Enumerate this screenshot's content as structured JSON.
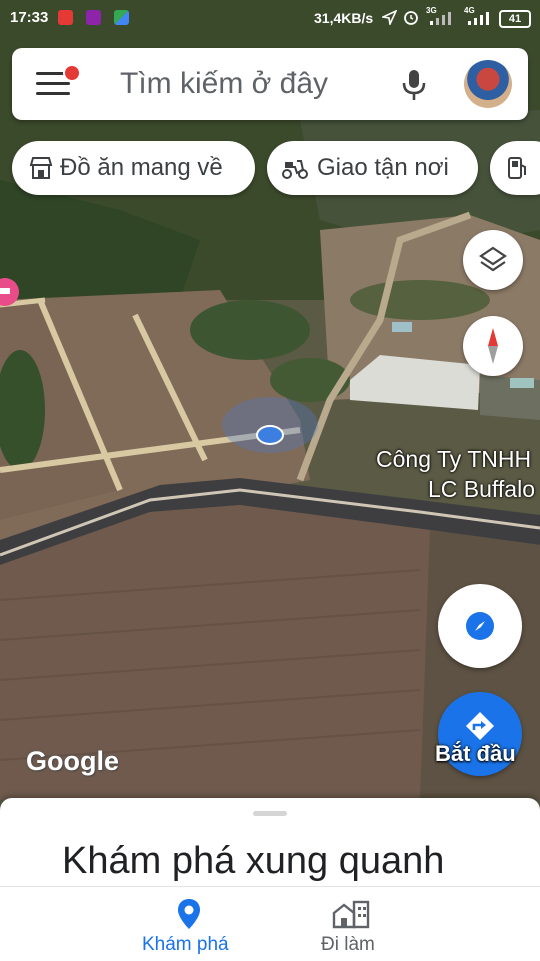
{
  "status_bar": {
    "time": "17:33",
    "network_speed": "31,4KB/s",
    "signal_labels": [
      "3G",
      "4G"
    ],
    "battery": "41"
  },
  "search": {
    "placeholder": "Tìm kiếm ở đây"
  },
  "chips": [
    {
      "label": "Đồ ăn mang về",
      "icon": "storefront-icon"
    },
    {
      "label": "Giao tận nơi",
      "icon": "delivery-scooter-icon"
    },
    {
      "label": "",
      "icon": "gas-station-icon"
    }
  ],
  "map": {
    "place_label": "Công Ty TNHH LC Buffalo",
    "place_label_line1": "Công Ty TNHH",
    "place_label_line2": "LC Buffalo",
    "attribution": "Google"
  },
  "buttons": {
    "start_label": "Bắt đầu"
  },
  "sheet": {
    "title": "Khám phá xung quanh"
  },
  "nav": [
    {
      "label": "Khám phá",
      "icon": "location-pin-icon",
      "active": true
    },
    {
      "label": "Đi làm",
      "icon": "commute-building-icon",
      "active": false
    }
  ],
  "colors": {
    "accent": "#1a73e8",
    "notification_dot": "#e53935"
  }
}
